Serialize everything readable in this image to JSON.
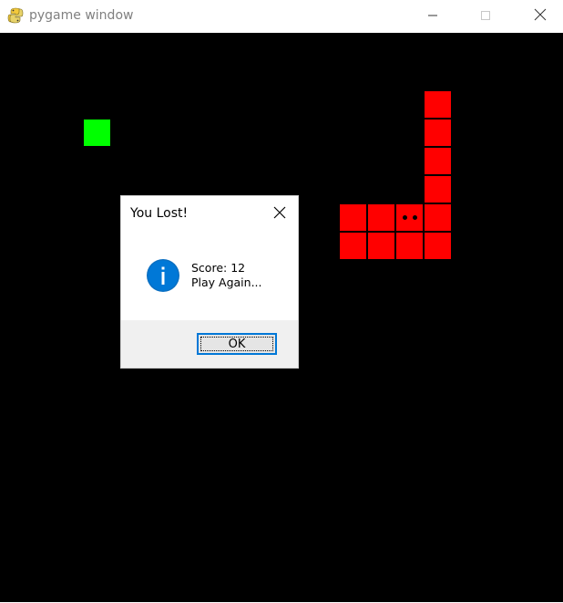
{
  "window": {
    "title": "pygame window",
    "icon": "python-snake-icon",
    "controls": [
      "minimize-icon",
      "maximize-icon",
      "close-icon"
    ]
  },
  "game": {
    "background": "#000000",
    "food_color": "#00ff00",
    "snake_color": "#ff0000",
    "snake_length": 12
  },
  "dialog": {
    "title": "You Lost!",
    "icon": "info-icon",
    "message_line1": "Score: 12",
    "message_line2": "Play Again...",
    "ok_label": "OK",
    "close_icon": "close-icon"
  }
}
